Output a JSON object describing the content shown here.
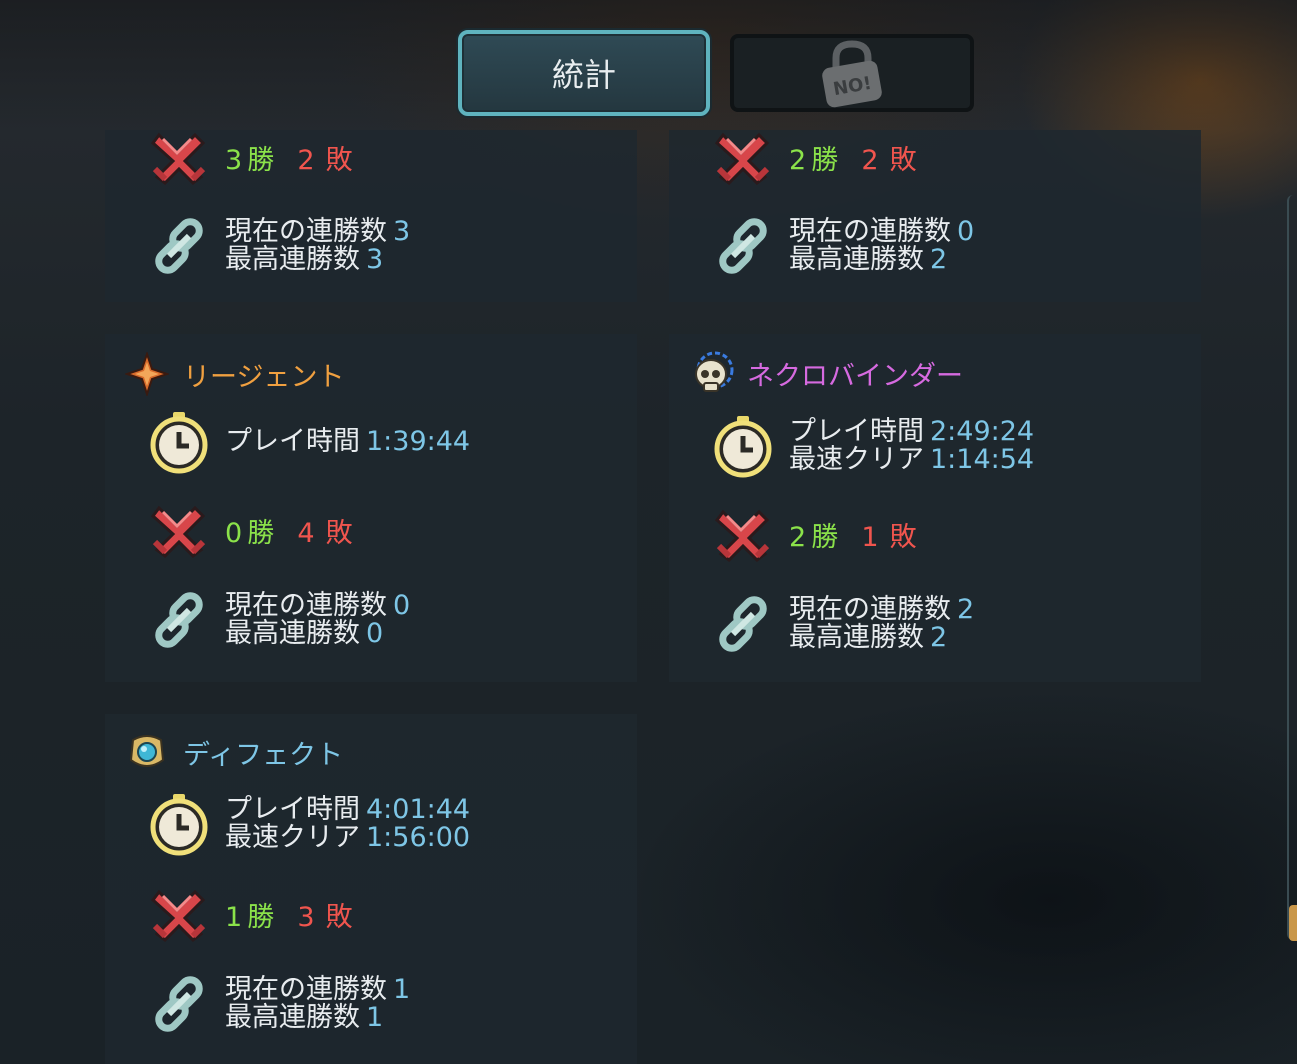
{
  "tabs": {
    "stats_label": "統計",
    "locked_badge": "NO!"
  },
  "labels": {
    "play_time": "プレイ時間",
    "fastest_clear": "最速クリア",
    "current_streak": "現在の連勝数",
    "best_streak": "最高連勝数"
  },
  "characters": [
    {
      "name": "",
      "wins": "3",
      "wins_suffix": "勝",
      "losses": "2",
      "losses_suffix": "敗",
      "current_streak": "3",
      "best_streak": "3"
    },
    {
      "name": "",
      "wins": "2",
      "wins_suffix": "勝",
      "losses": "2",
      "losses_suffix": "敗",
      "current_streak": "0",
      "best_streak": "2"
    },
    {
      "name": "リージェント",
      "name_color": "#f0a040",
      "icon": "regent-star-icon",
      "play_time": "1:39:44",
      "wins": "0",
      "wins_suffix": "勝",
      "losses": "4",
      "losses_suffix": "敗",
      "current_streak": "0",
      "best_streak": "0"
    },
    {
      "name": "ネクロバインダー",
      "name_color": "#d66ae0",
      "icon": "skull-icon",
      "play_time": "2:49:24",
      "fastest_clear": "1:14:54",
      "wins": "2",
      "wins_suffix": "勝",
      "losses": "1",
      "losses_suffix": "敗",
      "current_streak": "2",
      "best_streak": "2"
    },
    {
      "name": "ディフェクト",
      "name_color": "#7ec6e6",
      "icon": "orb-icon",
      "play_time": "4:01:44",
      "fastest_clear": "1:56:00",
      "wins": "1",
      "wins_suffix": "勝",
      "losses": "3",
      "losses_suffix": "敗",
      "current_streak": "1",
      "best_streak": "1"
    }
  ],
  "colors": {
    "win": "#8be24a",
    "loss": "#f0554e",
    "value": "#7ec6e6",
    "tab_border": "#5fb3be"
  }
}
